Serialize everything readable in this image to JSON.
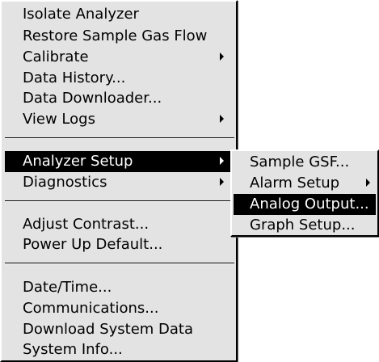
{
  "main_menu": {
    "items": [
      {
        "label": "Isolate Analyzer"
      },
      {
        "label": "Restore Sample Gas Flow"
      },
      {
        "label": "Calibrate",
        "submenu_icon": "submenu-arrow-icon"
      },
      {
        "label": "Data History..."
      },
      {
        "label": "Data Downloader..."
      },
      {
        "label": "View Logs",
        "submenu_icon": "submenu-arrow-icon"
      },
      {
        "label": "Analyzer Setup",
        "submenu_icon": "submenu-arrow-icon",
        "selected": true
      },
      {
        "label": "Diagnostics",
        "submenu_icon": "submenu-arrow-icon"
      },
      {
        "label": "Adjust Contrast..."
      },
      {
        "label": "Power Up Default..."
      },
      {
        "label": "Date/Time..."
      },
      {
        "label": "Communications..."
      },
      {
        "label": "Download System Data"
      },
      {
        "label": "System Info..."
      }
    ]
  },
  "sub_menu": {
    "parent": "Analyzer Setup",
    "items": [
      {
        "label": "Sample GSF..."
      },
      {
        "label": "Alarm Setup",
        "submenu_icon": "submenu-arrow-icon"
      },
      {
        "label": "Analog Output...",
        "selected": true
      },
      {
        "label": "Graph Setup..."
      }
    ]
  },
  "colors": {
    "menu_background": "#e3e3e3",
    "highlight_background": "#000000",
    "highlight_text": "#ffffff",
    "text": "#000000"
  }
}
